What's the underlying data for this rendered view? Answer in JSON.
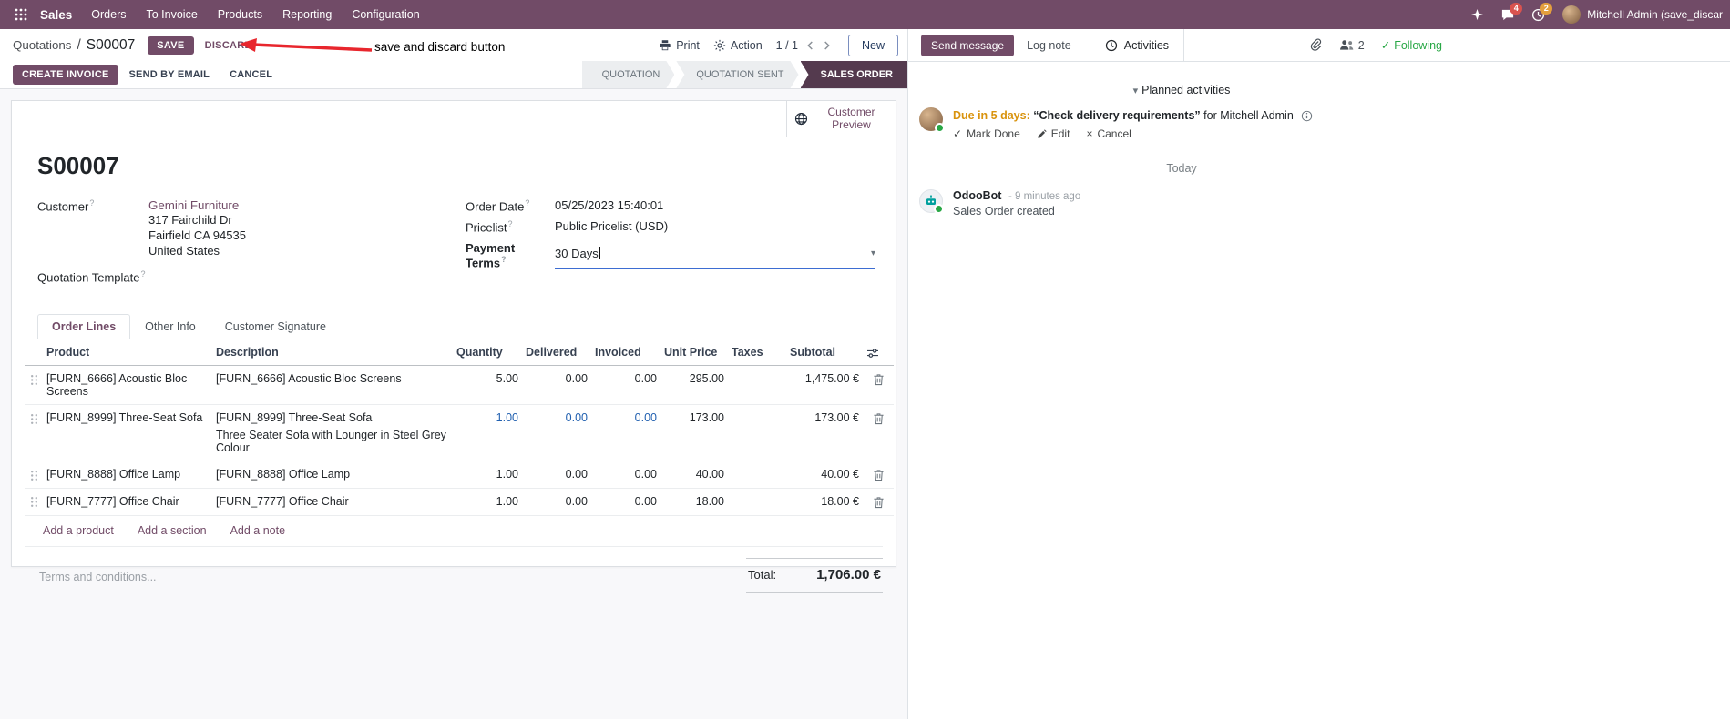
{
  "colors": {
    "brand": "#714B67",
    "statusbar_active": "#543a4e",
    "link": "#714B67",
    "highlight_blue": "#2160b0",
    "due_warning": "#d9930d",
    "following_green": "#28a745",
    "annotation_red": "#e8262d",
    "badge_message": "#d9534f",
    "badge_activity": "#e49f3d"
  },
  "navbar": {
    "app_name": "Sales",
    "menu_items": [
      "Orders",
      "To Invoice",
      "Products",
      "Reporting",
      "Configuration"
    ],
    "messages_badge": "4",
    "activities_badge": "2",
    "user_name": "Mitchell Admin (save_discar"
  },
  "control_panel": {
    "breadcrumb_parent": "Quotations",
    "breadcrumb_separator": "/",
    "breadcrumb_current": "S00007",
    "save_label": "SAVE",
    "discard_label": "DISCARD",
    "annotation_text": "save and discard button",
    "print_label": "Print",
    "action_label": "Action",
    "pager_value": "1 / 1",
    "new_label": "New"
  },
  "statusbar": {
    "create_invoice": "CREATE INVOICE",
    "send_by_email": "SEND BY EMAIL",
    "cancel": "CANCEL",
    "states": [
      "QUOTATION",
      "QUOTATION SENT",
      "SALES ORDER"
    ],
    "active_state": "SALES ORDER"
  },
  "form": {
    "customer_preview_label": "Customer Preview",
    "title": "S00007",
    "help_marker": "?",
    "customer_label": "Customer",
    "customer_name": "Gemini Furniture",
    "customer_address_line1": "317 Fairchild Dr",
    "customer_address_line2": "Fairfield CA 94535",
    "customer_address_line3": "United States",
    "quotation_template_label": "Quotation Template",
    "order_date_label": "Order Date",
    "order_date_value": "05/25/2023 15:40:01",
    "pricelist_label": "Pricelist",
    "pricelist_value": "Public Pricelist (USD)",
    "payment_terms_label": "Payment Terms",
    "payment_terms_value": "30 Days",
    "tabs": [
      "Order Lines",
      "Other Info",
      "Customer Signature"
    ]
  },
  "order_lines": {
    "columns": [
      "Product",
      "Description",
      "Quantity",
      "Delivered",
      "Invoiced",
      "Unit Price",
      "Taxes",
      "Subtotal"
    ],
    "rows": [
      {
        "product": "[FURN_6666] Acoustic Bloc Screens",
        "description": "[FURN_6666] Acoustic Bloc Screens",
        "description_line2": "",
        "quantity": "5.00",
        "delivered": "0.00",
        "invoiced": "0.00",
        "unit_price": "295.00",
        "taxes": "",
        "subtotal": "1,475.00 €"
      },
      {
        "product": "[FURN_8999] Three-Seat Sofa",
        "description": "[FURN_8999] Three-Seat Sofa",
        "description_line2": "Three Seater Sofa with Lounger in Steel Grey Colour",
        "quantity": "1.00",
        "delivered": "0.00",
        "invoiced": "0.00",
        "unit_price": "173.00",
        "taxes": "",
        "subtotal": "173.00 €"
      },
      {
        "product": "[FURN_8888] Office Lamp",
        "description": "[FURN_8888] Office Lamp",
        "description_line2": "",
        "quantity": "1.00",
        "delivered": "0.00",
        "invoiced": "0.00",
        "unit_price": "40.00",
        "taxes": "",
        "subtotal": "40.00 €"
      },
      {
        "product": "[FURN_7777] Office Chair",
        "description": "[FURN_7777] Office Chair",
        "description_line2": "",
        "quantity": "1.00",
        "delivered": "0.00",
        "invoiced": "0.00",
        "unit_price": "18.00",
        "taxes": "",
        "subtotal": "18.00 €"
      }
    ],
    "add_product": "Add a product",
    "add_section": "Add a section",
    "add_note": "Add a note",
    "terms_placeholder": "Terms and conditions...",
    "total_label": "Total:",
    "total_value": "1,706.00 €"
  },
  "chatter": {
    "send_message": "Send message",
    "log_note": "Log note",
    "activities_tab": "Activities",
    "followers_count": "2",
    "following_label": "Following",
    "planned_activities_header": "Planned activities",
    "activity": {
      "due_text": "Due in 5 days:",
      "summary": "“Check delivery requirements”",
      "assignee_text": "for Mitchell Admin",
      "mark_done": "Mark Done",
      "edit": "Edit",
      "cancel": "Cancel"
    },
    "date_divider": "Today",
    "message": {
      "author": "OdooBot",
      "timestamp": "- 9 minutes ago",
      "body": "Sales Order created"
    }
  },
  "icons": {
    "caret_down": "▾",
    "check": "✓",
    "close": "×"
  }
}
